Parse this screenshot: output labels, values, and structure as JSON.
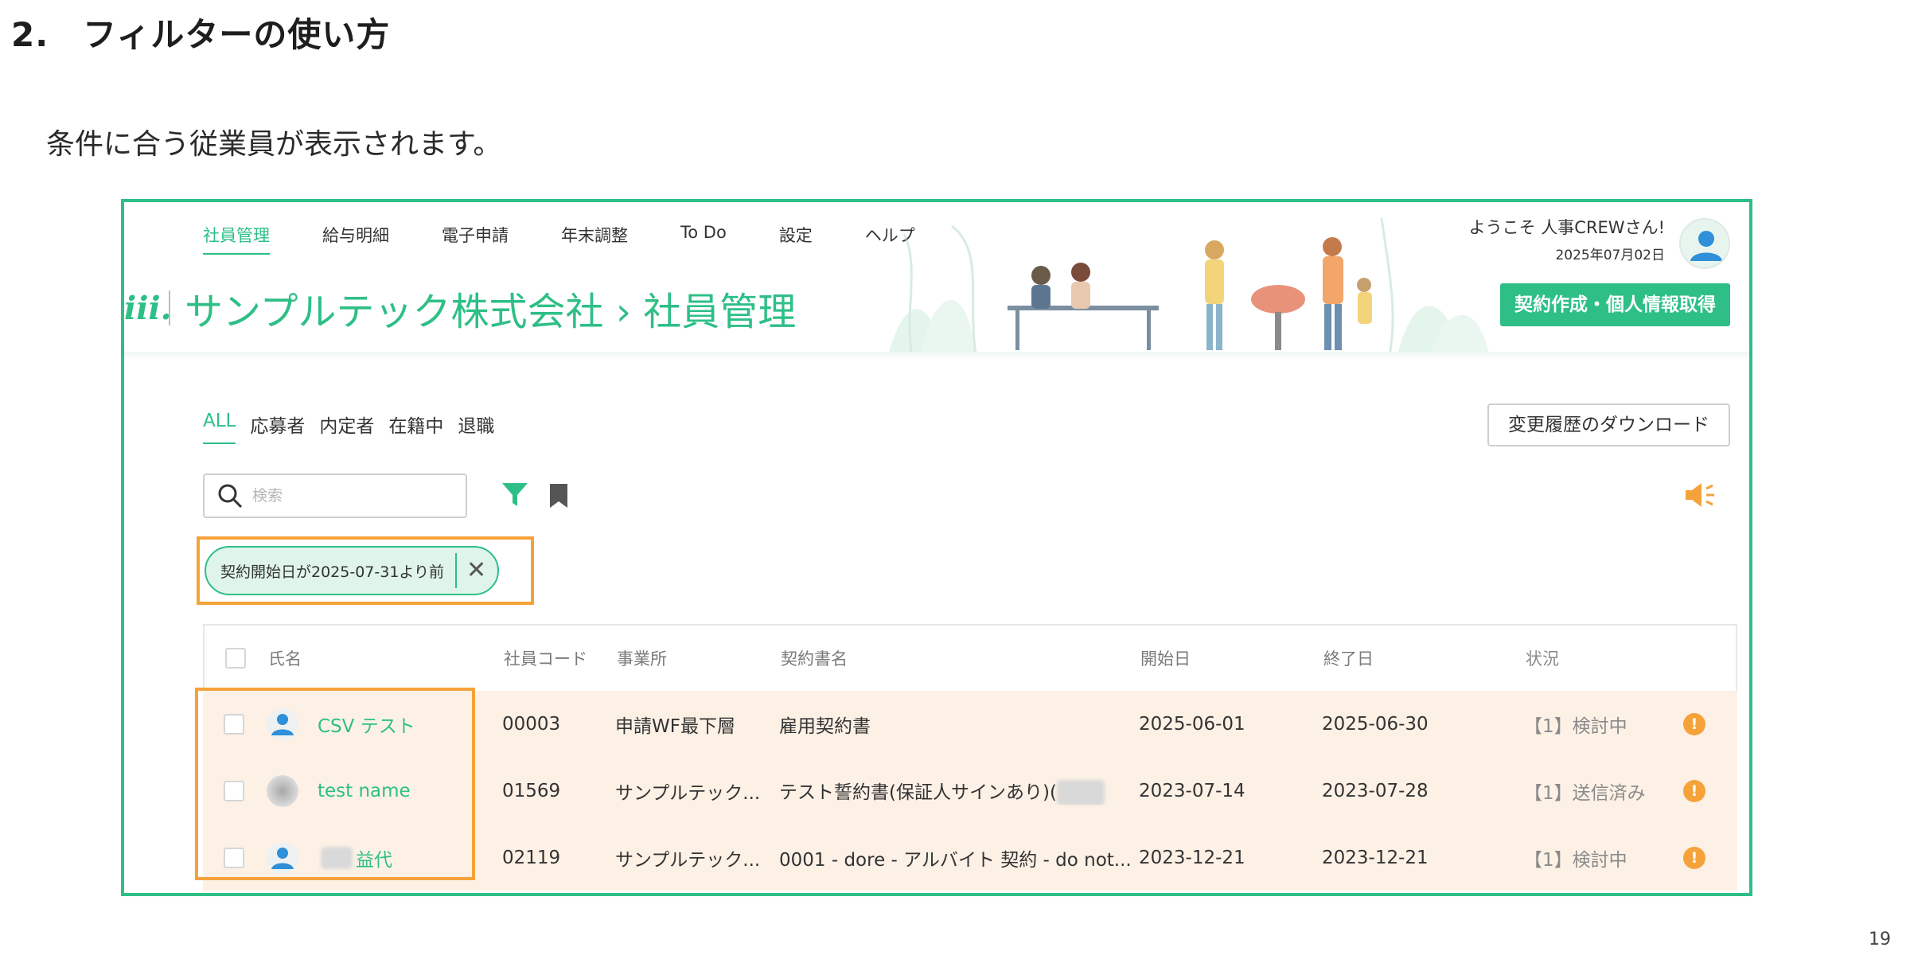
{
  "slide": {
    "heading": "2.　フィルターの使い方",
    "description": "条件に合う従業員が表示されます。",
    "page_number": "19"
  },
  "app": {
    "nav": [
      "社員管理",
      "給与明細",
      "電子申請",
      "年末調整",
      "To Do",
      "設定",
      "ヘルプ"
    ],
    "brand_logo": "iii.",
    "brand_title": "サンプルテック株式会社 › 社員管理",
    "welcome": "ようこそ 人事CREWさん!",
    "date": "2025年07月02日",
    "contract_button": "契約作成・個人情報取得",
    "accent_color": "#2ebf86",
    "highlight_color": "#f5a23a"
  },
  "content": {
    "tabs": [
      "ALL",
      "応募者",
      "内定者",
      "在籍中",
      "退職"
    ],
    "download_button": "変更履歴のダウンロード",
    "search_placeholder": "検索",
    "filter_chip": "契約開始日が2025-07-31より前",
    "filter_chip_close": "✕"
  },
  "table": {
    "headers": {
      "name": "氏名",
      "code": "社員コード",
      "office": "事業所",
      "contract": "契約書名",
      "start": "開始日",
      "end": "終了日",
      "status": "状況"
    },
    "rows": [
      {
        "name": "CSV テスト",
        "code": "00003",
        "office": "申請WF最下層",
        "contract": "雇用契約書",
        "start": "2025-06-01",
        "end": "2025-06-30",
        "status": "【1】検討中",
        "alert": "!"
      },
      {
        "name": "test name",
        "code": "01569",
        "office": "サンプルテック...",
        "contract": "テスト誓約書(保証人サインあり)(",
        "start": "2023-07-14",
        "end": "2023-07-28",
        "status": "【1】送信済み",
        "alert": "!"
      },
      {
        "name": "益代",
        "code": "02119",
        "office": "サンプルテック...",
        "contract": "0001 - dore - アルバイト 契約 - do not...",
        "start": "2023-12-21",
        "end": "2023-12-21",
        "status": "【1】検討中",
        "alert": "!"
      }
    ]
  }
}
